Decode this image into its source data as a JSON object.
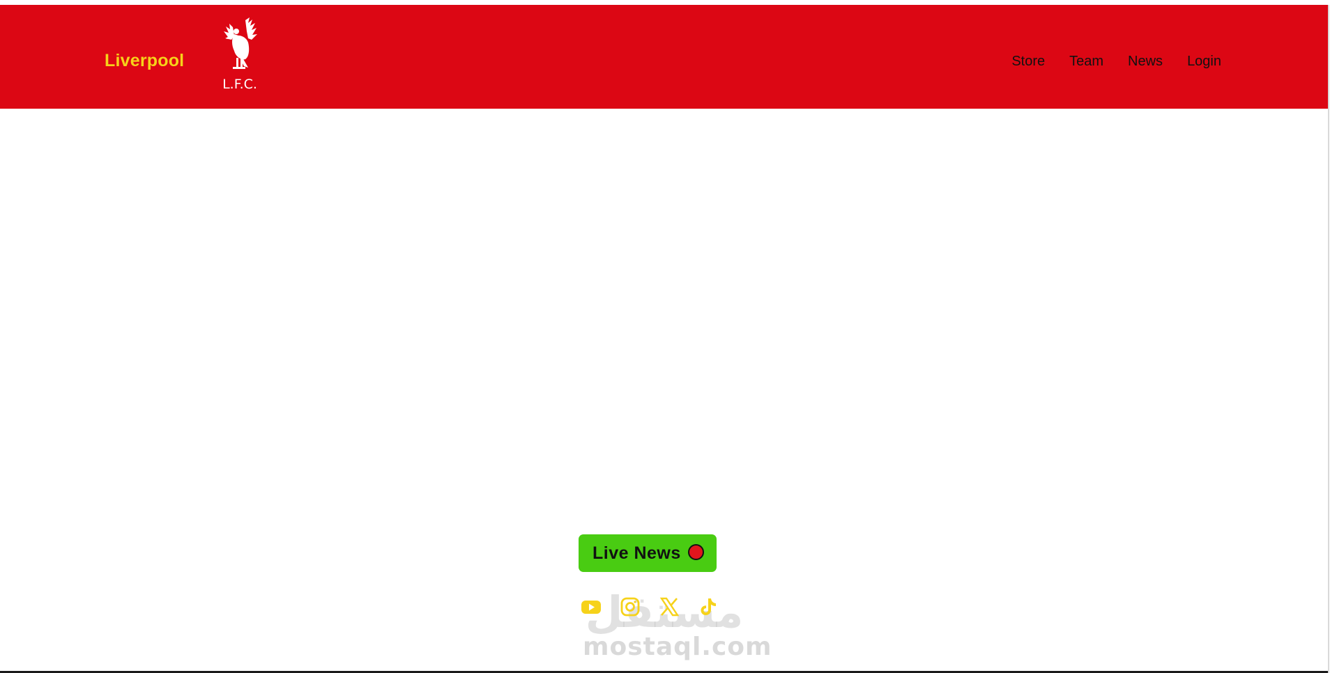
{
  "header": {
    "brand_name": "Liverpool",
    "crest_caption": "L.F.C.",
    "background_color": "#dc0714",
    "brand_color": "#f6d21a"
  },
  "nav": {
    "items": [
      {
        "label": "Store"
      },
      {
        "label": "Team"
      },
      {
        "label": "News"
      },
      {
        "label": "Login"
      }
    ]
  },
  "live_news": {
    "label": "Live News",
    "button_color": "#49cc12",
    "indicator_color": "#e0161d"
  },
  "socials": {
    "icon_color": "#f6d21a",
    "items": [
      {
        "icon": "youtube-icon"
      },
      {
        "icon": "instagram-icon"
      },
      {
        "icon": "x-icon"
      },
      {
        "icon": "tiktok-icon"
      }
    ]
  },
  "watermark": {
    "arabic": "مستقل",
    "latin": "mostaql.com"
  }
}
